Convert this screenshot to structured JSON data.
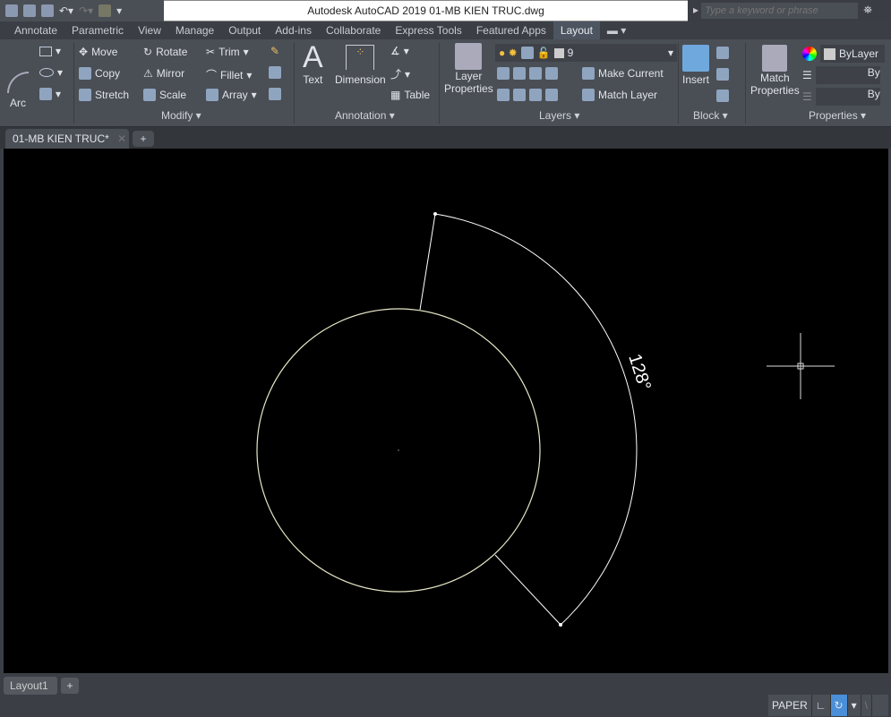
{
  "window": {
    "title": "Autodesk AutoCAD 2019    01-MB KIEN TRUC.dwg",
    "search_placeholder": "Type a keyword or phrase"
  },
  "menu_tabs": [
    "Annotate",
    "Parametric",
    "View",
    "Manage",
    "Output",
    "Add-ins",
    "Collaborate",
    "Express Tools",
    "Featured Apps",
    "Layout"
  ],
  "active_tab": "Layout",
  "ribbon": {
    "draw": {
      "arc": "Arc"
    },
    "modify": {
      "title": "Modify",
      "move": "Move",
      "rotate": "Rotate",
      "trim": "Trim",
      "copy": "Copy",
      "mirror": "Mirror",
      "fillet": "Fillet",
      "stretch": "Stretch",
      "scale": "Scale",
      "array": "Array"
    },
    "annotation": {
      "title": "Annotation",
      "text": "Text",
      "dimension": "Dimension",
      "table": "Table"
    },
    "layers": {
      "title": "Layers",
      "layer_properties_1": "Layer",
      "layer_properties_2": "Properties",
      "layer_value": "9",
      "make_current": "Make Current",
      "match_layer": "Match Layer"
    },
    "block": {
      "title": "Block",
      "insert": "Insert"
    },
    "properties": {
      "title": "Properties",
      "match_1": "Match",
      "match_2": "Properties",
      "color": "ByLayer",
      "linetype": "By",
      "lineweight": "By"
    }
  },
  "document_tab": "01-MB KIEN TRUC*",
  "drawing": {
    "angle_dimension": "128°",
    "line_color": "#e8e8c8",
    "dim_color": "#ffffff"
  },
  "layout_tab": "Layout1",
  "status": {
    "paper": "PAPER"
  },
  "colors": {
    "ribbon_bg": "#4a4e55",
    "canvas_bg": "#000000",
    "active_status": "#4a8fd8"
  }
}
